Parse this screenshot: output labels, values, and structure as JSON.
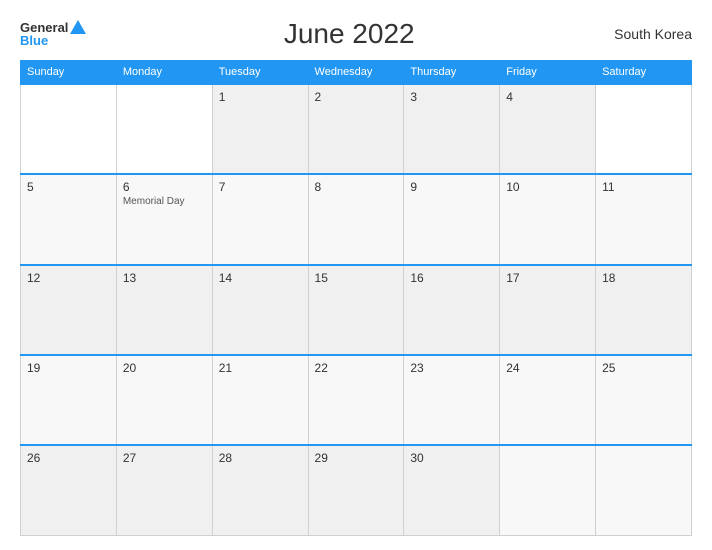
{
  "header": {
    "title": "June 2022",
    "country": "South Korea",
    "logo_general": "General",
    "logo_blue": "Blue"
  },
  "calendar": {
    "days_of_week": [
      "Sunday",
      "Monday",
      "Tuesday",
      "Wednesday",
      "Thursday",
      "Friday",
      "Saturday"
    ],
    "weeks": [
      [
        {
          "date": "",
          "events": []
        },
        {
          "date": "",
          "events": []
        },
        {
          "date": "1",
          "events": []
        },
        {
          "date": "2",
          "events": []
        },
        {
          "date": "3",
          "events": []
        },
        {
          "date": "4",
          "events": []
        }
      ],
      [
        {
          "date": "5",
          "events": []
        },
        {
          "date": "6",
          "events": [
            "Memorial Day"
          ]
        },
        {
          "date": "7",
          "events": []
        },
        {
          "date": "8",
          "events": []
        },
        {
          "date": "9",
          "events": []
        },
        {
          "date": "10",
          "events": []
        },
        {
          "date": "11",
          "events": []
        }
      ],
      [
        {
          "date": "12",
          "events": []
        },
        {
          "date": "13",
          "events": []
        },
        {
          "date": "14",
          "events": []
        },
        {
          "date": "15",
          "events": []
        },
        {
          "date": "16",
          "events": []
        },
        {
          "date": "17",
          "events": []
        },
        {
          "date": "18",
          "events": []
        }
      ],
      [
        {
          "date": "19",
          "events": []
        },
        {
          "date": "20",
          "events": []
        },
        {
          "date": "21",
          "events": []
        },
        {
          "date": "22",
          "events": []
        },
        {
          "date": "23",
          "events": []
        },
        {
          "date": "24",
          "events": []
        },
        {
          "date": "25",
          "events": []
        }
      ],
      [
        {
          "date": "26",
          "events": []
        },
        {
          "date": "27",
          "events": []
        },
        {
          "date": "28",
          "events": []
        },
        {
          "date": "29",
          "events": []
        },
        {
          "date": "30",
          "events": []
        },
        {
          "date": "",
          "events": []
        },
        {
          "date": "",
          "events": []
        }
      ]
    ]
  }
}
